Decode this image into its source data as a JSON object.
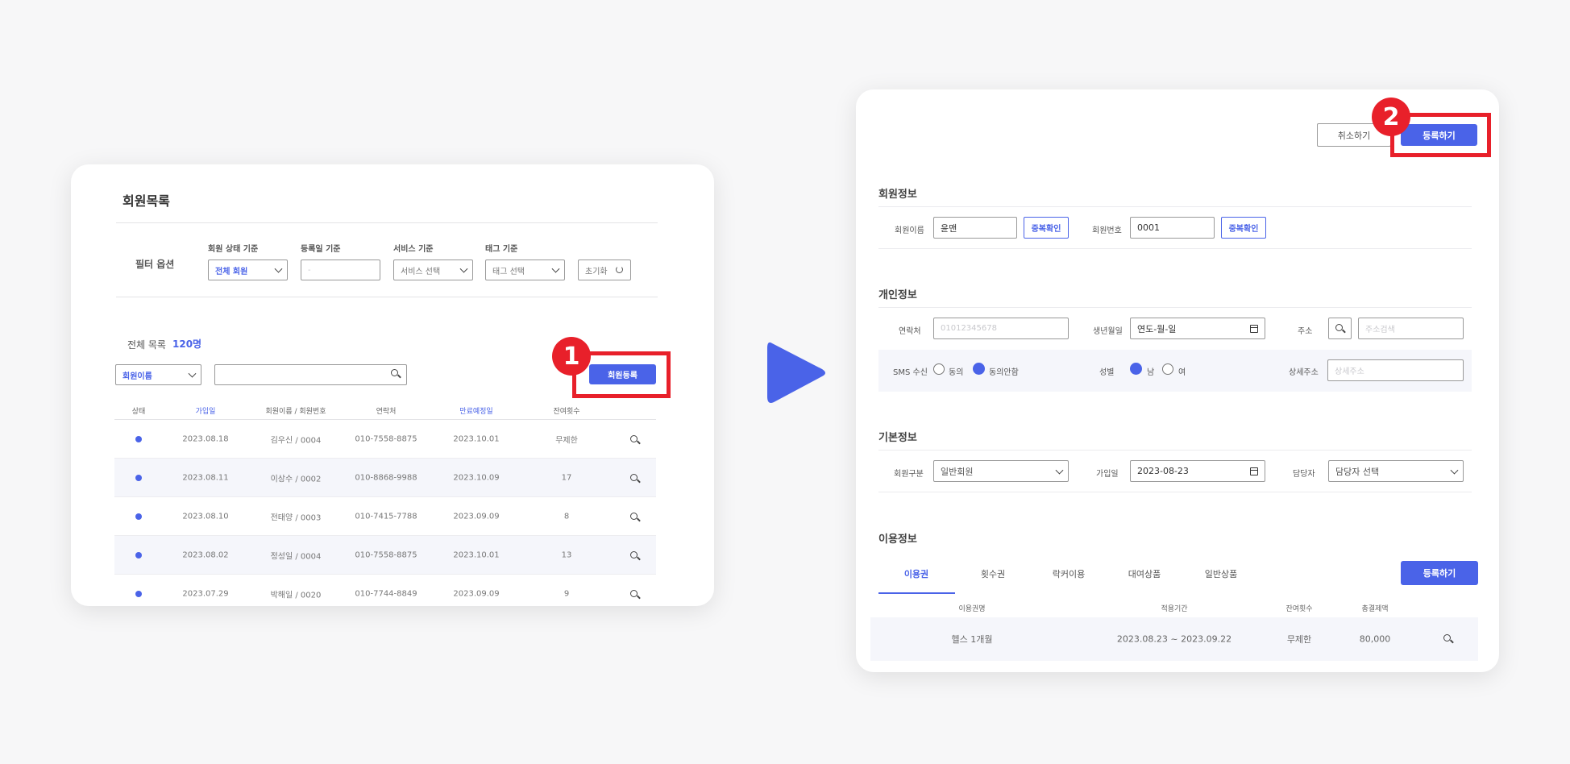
{
  "list_screen": {
    "title": "회원목록",
    "filter": {
      "label": "필터 옵션",
      "status_label": "회원 상태 기준",
      "status_value": "전체 회원",
      "date_label": "등록일 기준",
      "date_value": "-",
      "service_label": "서비스 기준",
      "service_value": "서비스 선택",
      "tag_label": "태그 기준",
      "tag_value": "태그 선택",
      "reset_label": "초기화"
    },
    "total_label": "전체 목록",
    "total_count": "120명",
    "search_type": "회원이름",
    "search_value": "",
    "register_button": "회원등록",
    "badge": "1",
    "columns": [
      "상태",
      "가입일",
      "회원이름 / 회원번호",
      "연락처",
      "만료예정일",
      "잔여횟수"
    ],
    "rows": [
      {
        "joined": "2023.08.18",
        "name": "김우신 / 0004",
        "phone": "010-7558-8875",
        "expires": "2023.10.01",
        "remaining": "무제한"
      },
      {
        "joined": "2023.08.11",
        "name": "이상수 / 0002",
        "phone": "010-8868-9988",
        "expires": "2023.10.09",
        "remaining": "17"
      },
      {
        "joined": "2023.08.10",
        "name": "전태양 / 0003",
        "phone": "010-7415-7788",
        "expires": "2023.09.09",
        "remaining": "8"
      },
      {
        "joined": "2023.08.02",
        "name": "정성일 / 0004",
        "phone": "010-7558-8875",
        "expires": "2023.10.01",
        "remaining": "13"
      },
      {
        "joined": "2023.07.29",
        "name": "박해일 / 0020",
        "phone": "010-7744-8849",
        "expires": "2023.09.09",
        "remaining": "9"
      }
    ]
  },
  "form_screen": {
    "cancel_button": "취소하기",
    "submit_button": "등록하기",
    "badge": "2",
    "member_info": {
      "title": "회원정보",
      "name_label": "회원이름",
      "name_value": "윤맨",
      "check_button": "중복확인",
      "number_label": "회원번호",
      "number_value": "0001"
    },
    "personal_info": {
      "title": "개인정보",
      "phone_label": "연락처",
      "phone_placeholder": "01012345678",
      "birth_label": "생년월일",
      "birth_value": "연도-월-일",
      "address_label": "주소",
      "address_placeholder": "주소검색",
      "sms_label": "SMS 수신",
      "sms_options": [
        "동의",
        "동의안함"
      ],
      "sms_selected": "동의안함",
      "gender_label": "성별",
      "gender_options": [
        "남",
        "여"
      ],
      "gender_selected": "남",
      "detail_address_label": "상세주소",
      "detail_address_placeholder": "상세주소"
    },
    "basic_info": {
      "title": "기본정보",
      "type_label": "회원구분",
      "type_value": "일반회원",
      "join_label": "가입일",
      "join_value": "2023-08-23",
      "manager_label": "담당자",
      "manager_value": "담당자 선택"
    },
    "usage_info": {
      "title": "이용정보",
      "tabs": [
        "이용권",
        "횟수권",
        "락커이용",
        "대여상품",
        "일반상품"
      ],
      "active_tab": "이용권",
      "register_button": "등록하기",
      "columns": [
        "이용권명",
        "적용기간",
        "잔여횟수",
        "총결제액"
      ],
      "row": {
        "name": "헬스 1개월",
        "period": "2023.08.23 ~ 2023.09.22",
        "remaining": "무제한",
        "amount": "80,000"
      }
    }
  },
  "colors": {
    "accent": "#4a63e8",
    "highlight": "#e8202a",
    "background": "#f7f7f8"
  }
}
